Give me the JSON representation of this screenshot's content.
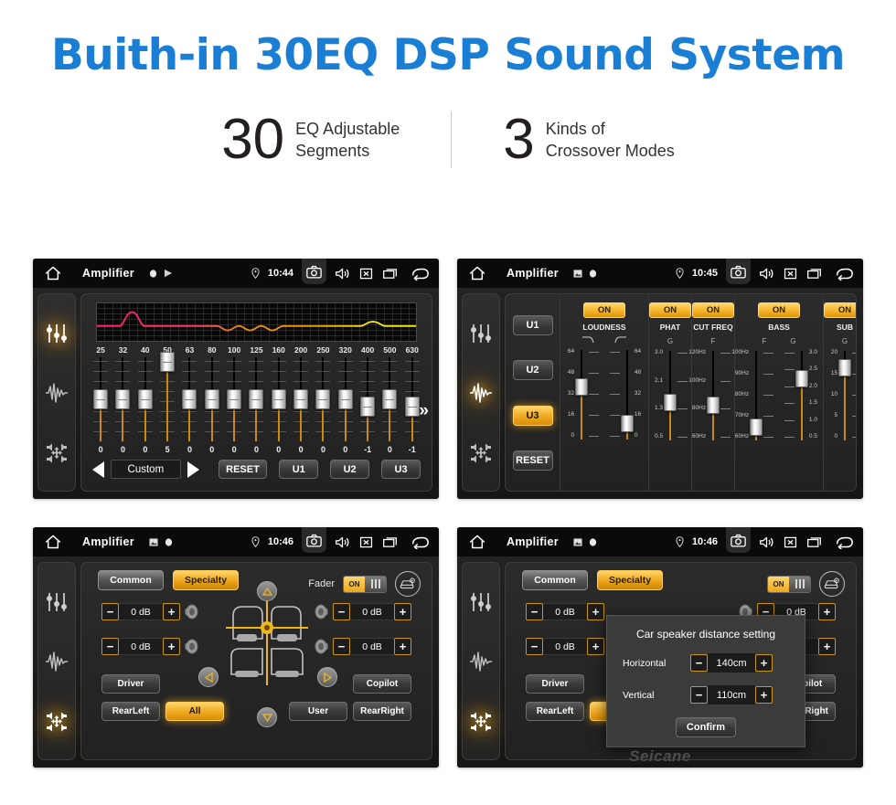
{
  "headline": "Buith-in 30EQ DSP Sound System",
  "stats": [
    {
      "number": "30",
      "line1": "EQ Adjustable",
      "line2": "Segments"
    },
    {
      "number": "3",
      "line1": "Kinds of",
      "line2": "Crossover Modes"
    }
  ],
  "colors": {
    "headline_blue": "#1a7fd4",
    "accent_amber": "#f0a81e",
    "panel_dark": "#222222",
    "curve_start": "#ff1f6b",
    "curve_mid": "#ee8a12",
    "curve_end": "#f2e41c"
  },
  "statusbar": {
    "title": "Amplifier",
    "icons": [
      "home-icon",
      "camera-icon",
      "speaker-icon",
      "close-box-icon",
      "recents-icon",
      "back-icon",
      "location-pin-icon"
    ],
    "times": {
      "eq": "10:44",
      "dsp": "10:45",
      "balance": "10:46",
      "modal": "10:46"
    }
  },
  "rail": {
    "items": [
      {
        "name": "equalizer-icon",
        "active_on": "eq"
      },
      {
        "name": "waveform-icon",
        "active_on": "dsp"
      },
      {
        "name": "balance-icon",
        "active_on": "balance"
      }
    ]
  },
  "eq_screen": {
    "frequencies": [
      "25",
      "32",
      "40",
      "50",
      "63",
      "80",
      "100",
      "125",
      "160",
      "200",
      "250",
      "320",
      "400",
      "500",
      "630"
    ],
    "values": [
      "0",
      "0",
      "0",
      "5",
      "0",
      "0",
      "0",
      "0",
      "0",
      "0",
      "0",
      "0",
      "-1",
      "0",
      "-1"
    ],
    "preset_label": "Custom",
    "prev_label": "prev-preset",
    "next_label": "next-preset",
    "reset_label": "RESET",
    "user_presets": [
      "U1",
      "U2",
      "U3"
    ],
    "more_label": "»"
  },
  "dsp_screen": {
    "presets": [
      "U1",
      "U2",
      "U3"
    ],
    "active_preset": "U3",
    "reset_label": "RESET",
    "columns": [
      {
        "label": "LOUDNESS",
        "state": "ON",
        "headers": [
          "curve-low-icon",
          "curve-high-icon"
        ],
        "sliders": [
          {
            "scale": [
              "64",
              "48",
              "32",
              "16",
              "0"
            ],
            "side": "left",
            "value_pct": 50
          },
          {
            "scale": [
              "64",
              "48",
              "32",
              "16",
              "0"
            ],
            "side": "right",
            "value_pct": 8
          }
        ]
      },
      {
        "label": "PHAT",
        "state": "ON",
        "headers": [
          "G"
        ],
        "sliders": [
          {
            "scale": [
              "3.0",
              "2.1",
              "1.3",
              "0.5"
            ],
            "side": "left",
            "value_pct": 33
          }
        ]
      },
      {
        "label": "CUT FREQ",
        "state": "ON",
        "headers": [
          "F"
        ],
        "sliders": [
          {
            "scale": [
              "120Hz",
              "100Hz",
              "80Hz",
              "60Hz"
            ],
            "side": "left",
            "value_pct": 30
          }
        ]
      },
      {
        "label": "BASS",
        "state": "ON",
        "headers": [
          "F",
          "G"
        ],
        "sliders": [
          {
            "scale": [
              "100Hz",
              "90Hz",
              "80Hz",
              "70Hz",
              "60Hz"
            ],
            "side": "left",
            "value_pct": 5
          },
          {
            "scale": [
              "3.0",
              "2.5",
              "2.0",
              "1.5",
              "1.0",
              "0.5"
            ],
            "side": "right",
            "value_pct": 60
          }
        ]
      },
      {
        "label": "SUB",
        "state": "ON",
        "headers": [
          "G"
        ],
        "sliders": [
          {
            "scale": [
              "20",
              "15",
              "10",
              "5",
              "0"
            ],
            "side": "left",
            "value_pct": 73
          }
        ]
      }
    ]
  },
  "balance_screen": {
    "tabs": [
      {
        "label": "Common",
        "active": false
      },
      {
        "label": "Specialty",
        "active": true
      }
    ],
    "fader_label": "Fader",
    "fader_state": "ON",
    "car_setting_icon": "car-settings-icon",
    "steppers": [
      {
        "position": "front-left",
        "value": "0 dB",
        "minus": "−",
        "plus": "+"
      },
      {
        "position": "rear-left",
        "value": "0 dB",
        "minus": "−",
        "plus": "+"
      },
      {
        "position": "front-right",
        "value": "0 dB",
        "minus": "−",
        "plus": "+"
      },
      {
        "position": "rear-right",
        "value": "0 dB",
        "minus": "−",
        "plus": "+"
      }
    ],
    "seat_buttons": [
      {
        "label": "Driver",
        "active": false
      },
      {
        "label": "Copilot",
        "active": false
      },
      {
        "label": "RearLeft",
        "active": false
      },
      {
        "label": "All",
        "active": true
      },
      {
        "label": "User",
        "active": false
      },
      {
        "label": "RearRight",
        "active": false
      }
    ],
    "nav_arrows": [
      "up-arrow-icon",
      "down-arrow-icon",
      "left-arrow-icon",
      "right-arrow-icon"
    ]
  },
  "modal": {
    "title": "Car speaker distance setting",
    "rows": [
      {
        "label": "Horizontal",
        "value": "140cm",
        "minus": "−",
        "plus": "+"
      },
      {
        "label": "Vertical",
        "value": "110cm",
        "minus": "−",
        "plus": "+"
      }
    ],
    "confirm_label": "Confirm"
  },
  "watermark": "Seicane"
}
